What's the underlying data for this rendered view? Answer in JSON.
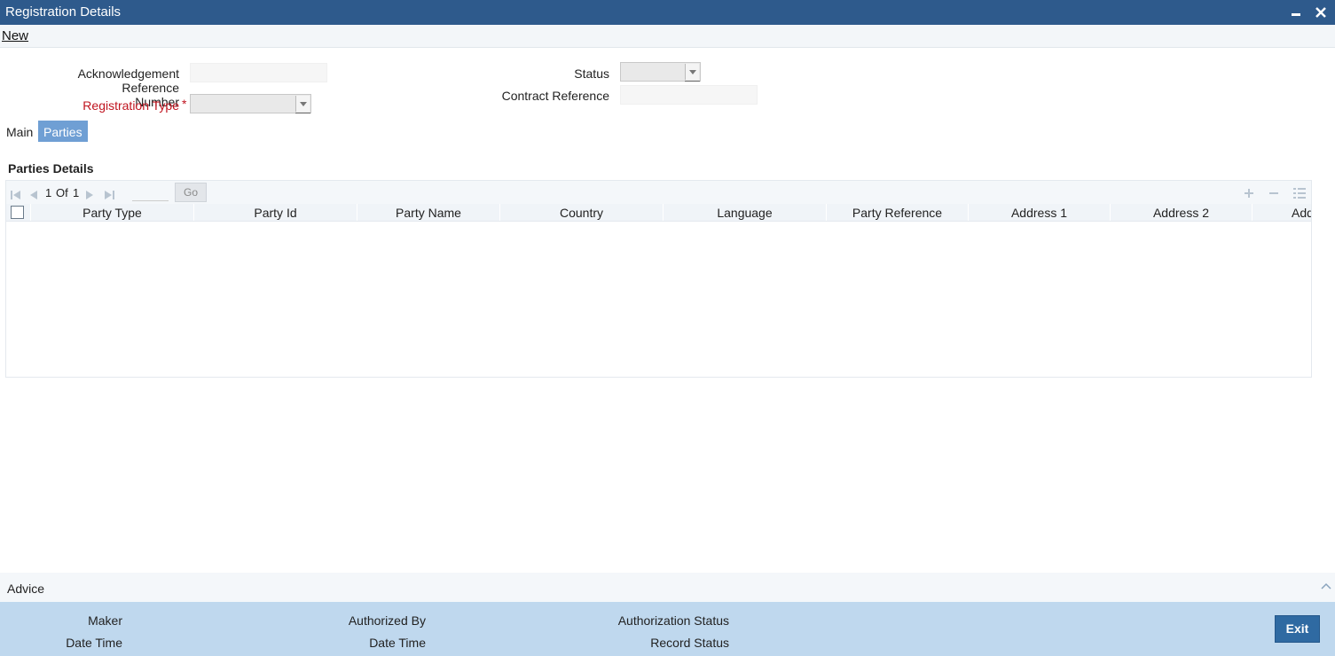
{
  "window": {
    "title": "Registration Details",
    "minimize_icon": "minimize-icon",
    "close_icon": "close-icon"
  },
  "menubar": {
    "new_label": "New"
  },
  "form": {
    "ack_ref_label_line1": "Acknowledgement Reference",
    "ack_ref_label_line2": "Number",
    "ack_ref_value": "",
    "reg_type_label": "Registration Type",
    "reg_type_required": "*",
    "reg_type_value": "",
    "status_label": "Status",
    "status_value": "",
    "contract_ref_label": "Contract Reference",
    "contract_ref_value": ""
  },
  "tabs": [
    {
      "label": "Main",
      "active": false
    },
    {
      "label": "Parties",
      "active": true
    }
  ],
  "parties": {
    "section_title": "Parties Details",
    "pager": {
      "current": "1",
      "of_label": "Of",
      "total": "1",
      "go_label": "Go"
    },
    "columns": [
      "Party Type",
      "Party Id",
      "Party Name",
      "Country",
      "Language",
      "Party Reference",
      "Address 1",
      "Address 2",
      "Add"
    ],
    "rows": []
  },
  "advice": {
    "label": "Advice"
  },
  "footer": {
    "maker_label": "Maker",
    "maker_datetime_label": "Date Time",
    "authorized_by_label": "Authorized By",
    "authorized_datetime_label": "Date Time",
    "authorization_status_label": "Authorization Status",
    "record_status_label": "Record Status",
    "exit_label": "Exit"
  },
  "colors": {
    "titlebar": "#2e5a8c",
    "active_tab": "#6f9fd4",
    "footer": "#bfd8ee",
    "exit_button": "#2f6aa2",
    "required": "#c0141f"
  }
}
